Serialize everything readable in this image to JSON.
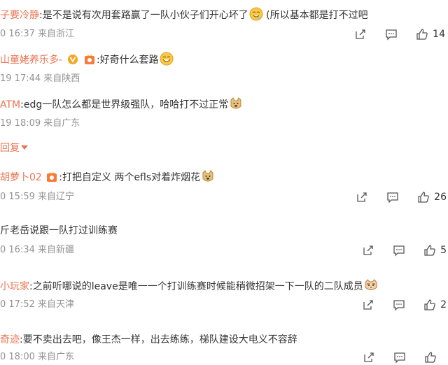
{
  "comments": [
    {
      "user": "子要冷静",
      "text": ":是不是说有次用套路赢了一队小伙子们开心坏了",
      "text2": "(所以基本都是打不过吧",
      "emoji": "drool-emoji",
      "meta": "0 16:37 来自浙江",
      "likes": "14"
    },
    {
      "user": "山童姥养乐多-",
      "text": ":好奇什么套路",
      "emoji": "smile-emoji",
      "meta": "19 17:44 来自陕西",
      "badges": [
        "v-badge",
        "fan-badge"
      ]
    },
    {
      "user": "ATM",
      "text": ":edg一队怎么都是世界级强队，哈哈打不过正常",
      "emoji": "doge-emoji",
      "meta": "19 18:09 来自广东"
    },
    {
      "user": "胡萝卜02",
      "text": ":打把自定义  两个efls对着炸烟花",
      "emoji": "doge-emoji",
      "meta": "0 15:59 来自辽宁",
      "likes": "26",
      "badges": [
        "fan-badge"
      ]
    },
    {
      "user": "",
      "text": "斤老岳说跟一队打过训练赛",
      "meta": "0 16:34 来自新疆",
      "likes": "5"
    },
    {
      "user": "小玩家",
      "text": ":之前听哪说的leave是唯一一个打训练赛时候能稍微招架一下一队的二队成员",
      "emoji": "cat-emoji",
      "meta": "0 17:52 来自天津",
      "likes": "2"
    },
    {
      "user": "奇迹",
      "text": ":要不卖出去吧，像王杰一样，出去练练，梯队建设大电义不容辞",
      "meta": "0 18:00 来自广东"
    }
  ],
  "reply_toggle": "回复",
  "icons": {
    "share": "share-icon",
    "comment": "comment-icon",
    "like": "like-icon"
  },
  "colors": {
    "username": "#eb7350",
    "meta": "#939393",
    "text": "#333333"
  }
}
